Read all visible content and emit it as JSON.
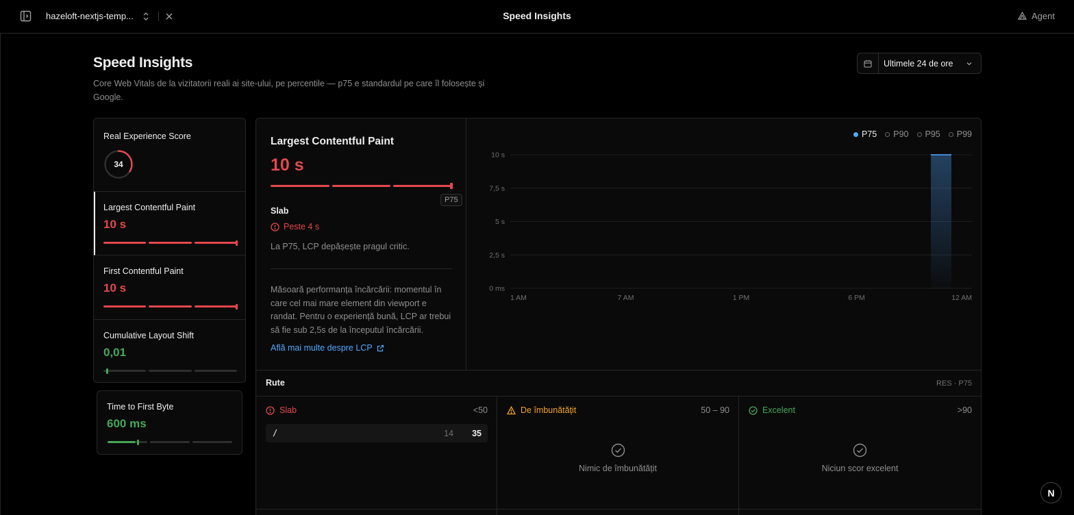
{
  "topbar": {
    "project": "hazeloft-nextjs-temp...",
    "title": "Speed Insights",
    "agent": "Agent"
  },
  "header": {
    "title": "Speed Insights",
    "subtitle": "Core Web Vitals de la vizitatorii reali ai site-ului, pe percentile — p75 e standardul pe care îl folosește și Google.",
    "range": "Ultimele 24 de ore"
  },
  "metrics": {
    "res": {
      "label": "Real Experience Score",
      "value": "34",
      "score_fraction": 0.34
    },
    "lcp": {
      "label": "Largest Contentful Paint",
      "value": "10 s"
    },
    "fcp": {
      "label": "First Contentful Paint",
      "value": "10 s"
    },
    "cls": {
      "label": "Cumulative Layout Shift",
      "value": "0,01"
    },
    "ttfb": {
      "label": "Time to First Byte",
      "value": "600 ms"
    }
  },
  "detail": {
    "title": "Largest Contentful Paint",
    "value": "10 s",
    "percentile_badge": "P75",
    "status": "Slab",
    "threshold": "Peste 4 s",
    "note": "La P75, LCP depășește pragul critic.",
    "description": "Măsoară performanța încărcării: momentul în care cel mai mare element din viewport e randat. Pentru o experiență bună, LCP ar trebui să fie sub 2,5s de la începutul încărcării.",
    "link": "Află mai multe despre LCP"
  },
  "legend": [
    "P75",
    "P90",
    "P95",
    "P99"
  ],
  "chart_data": {
    "type": "bar",
    "series": [
      {
        "name": "P75",
        "values": [
          10
        ]
      }
    ],
    "x": [
      "12 AM"
    ],
    "x_tick_labels": [
      "1 AM",
      "7 AM",
      "1 PM",
      "6 PM",
      "12 AM"
    ],
    "y_tick_labels": [
      "0 ms",
      "2,5 s",
      "5 s",
      "7,5 s",
      "10 s"
    ],
    "ylim": [
      0,
      10
    ],
    "grid": true,
    "legend_placement": "top-right",
    "bar_color": "#52a8ff"
  },
  "routes": {
    "title": "Rute",
    "meta": "RES · P75",
    "buckets": {
      "poor": {
        "label": "Slab",
        "range": "<50"
      },
      "improve": {
        "label": "De îmbunătățit",
        "range": "50 – 90",
        "empty": "Nimic de îmbunătățit"
      },
      "good": {
        "label": "Excelent",
        "range": ">90",
        "empty": "Niciun scor excelent"
      }
    },
    "rows": [
      {
        "path": "/",
        "count": "14",
        "score": "35"
      }
    ]
  },
  "colors": {
    "poor": "#e5484d",
    "improve": "#f5a524",
    "good": "#46a758",
    "accent": "#52a8ff"
  },
  "badge": "N"
}
